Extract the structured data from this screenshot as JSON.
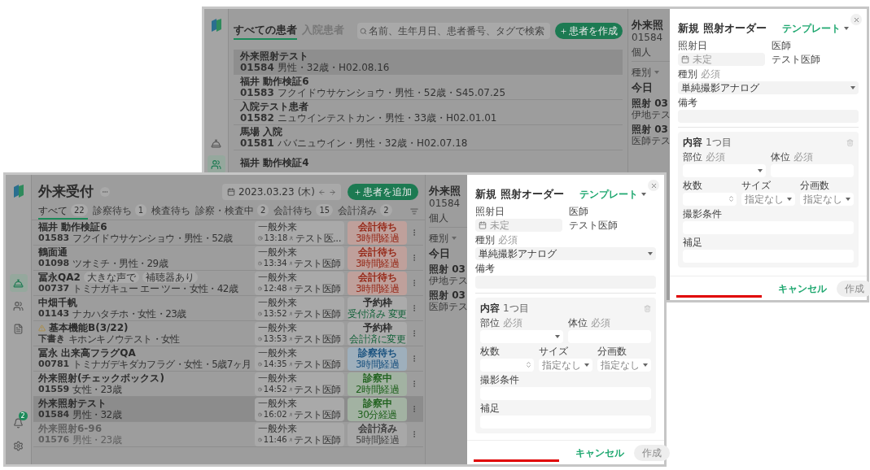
{
  "back_window": {
    "sidebar": [
      {
        "kind": "reception",
        "selected": false
      },
      {
        "kind": "patients",
        "selected": true
      }
    ],
    "tabs": [
      {
        "label": "すべての患者",
        "selected": true
      },
      {
        "label": "入院患者",
        "selected": false
      }
    ],
    "search": {
      "placeholder": "名前、生年月日、患者番号、タグで検索"
    },
    "add_button": "患者を作成",
    "patients": [
      {
        "name": "外来照射テスト",
        "id": "01584",
        "details": "男性・32歳・H02.08.16",
        "selected": true
      },
      {
        "name": "福井 動作検証6",
        "id": "01583",
        "details": "フクイドウサケンショウ・男性・52歳・S45.07.25",
        "selected": false
      },
      {
        "name": "入院テスト患者",
        "id": "01582",
        "details": "ニュウインテストカン・男性・33歳・H02.01.01",
        "selected": false
      },
      {
        "name": "馬場 入院",
        "id": "01581",
        "details": "ババニュウイン・男性・32歳・H02.07.18",
        "selected": false
      },
      {
        "name": "福井 動作検証4",
        "selected": false
      }
    ],
    "detail": {
      "title": "外来照",
      "id": "01584",
      "tab": "個人",
      "filter": "種別",
      "section": "今日",
      "entries": [
        {
          "title": "照射 03",
          "subtitle": "伊地テス"
        },
        {
          "title": "照射 03",
          "subtitle": "医師テス"
        }
      ]
    },
    "modal": {
      "title": "新規 照射オーダー",
      "template": "テンプレート",
      "rows": [
        [
          {
            "kind": "date",
            "label": "照射日",
            "placeholder": "未定"
          },
          {
            "kind": "static",
            "label": "医師",
            "value": "テスト医師"
          }
        ],
        [
          {
            "kind": "select",
            "label": "種別",
            "required": "必須",
            "value": "単純撮影アナログ"
          }
        ],
        [
          {
            "kind": "text",
            "label": "備考"
          }
        ]
      ],
      "section": {
        "title": "内容",
        "count": "1つ目",
        "rows": [
          [
            {
              "kind": "select",
              "label": "部位",
              "required": "必須"
            },
            {
              "kind": "text",
              "label": "体位",
              "required": "必須"
            }
          ],
          [
            {
              "kind": "number",
              "label": "枚数"
            },
            {
              "kind": "select",
              "label": "サイズ",
              "placeholder": "指定なし"
            },
            {
              "kind": "select",
              "label": "分画数",
              "placeholder": "指定なし"
            }
          ],
          [
            {
              "kind": "text",
              "label": "撮影条件"
            }
          ],
          [
            {
              "kind": "text",
              "label": "補足"
            }
          ]
        ]
      },
      "cancel": "キャンセル",
      "create": {
        "label": "作成",
        "disabled": true
      }
    }
  },
  "front_window": {
    "sidebar": [
      {
        "kind": "reception",
        "selected": true
      },
      {
        "kind": "patients",
        "selected": false
      },
      {
        "kind": "document",
        "selected": false
      },
      {
        "kind": "notifications",
        "selected": false,
        "badge": "2"
      },
      {
        "kind": "settings",
        "selected": false
      }
    ],
    "title": "外来受付",
    "date": "2023.03.23",
    "weekday": "(木)",
    "add_button": "患者を追加",
    "tabs": [
      {
        "label": "すべて",
        "count": "22",
        "selected": true
      },
      {
        "label": "診察待ち",
        "count": "1",
        "selected": false
      },
      {
        "label": "検査待ち",
        "selected": false
      },
      {
        "label": "診察・検査中",
        "count": "2",
        "selected": false
      },
      {
        "label": "会計待ち",
        "count": "15",
        "selected": false
      },
      {
        "label": "会計済み",
        "count": "2",
        "selected": false
      }
    ],
    "visits": [
      {
        "name": "福井 動作検証6",
        "warning": false,
        "id": "01583",
        "details": "フクイドウサケンショウ・男性・52歳",
        "visit_type": "一般外来",
        "time": "13:18",
        "doctor": "テスト医...",
        "status": {
          "kind": "billing",
          "label": "会計待ち",
          "note": "3時間経過"
        },
        "selected": false,
        "disabled": false
      },
      {
        "name": "鶴面通",
        "warning": false,
        "id": "01098",
        "details": "ツオミチ・男性・29歳",
        "visit_type": "一般外来",
        "time": "13:34",
        "doctor": "テスト医師",
        "status": {
          "kind": "billing",
          "label": "会計待ち",
          "note": "3時間経過"
        },
        "selected": false,
        "disabled": false
      },
      {
        "name": "冨永QA2",
        "tags": [
          "大きな声で",
          "補聴器あり"
        ],
        "warning": false,
        "id": "00737",
        "details": "トミナガキュー エー ツー・女性・42歳",
        "visit_type": "一般外来",
        "time": "12:48",
        "doctor": "テスト医師",
        "status": {
          "kind": "billing",
          "label": "会計待ち",
          "note": "3時間経過"
        },
        "selected": false,
        "disabled": false
      },
      {
        "name": "中畑千帆",
        "warning": false,
        "id": "01143",
        "details": "ナカハタチホ・女性・23歳",
        "visit_type": "一般外来",
        "time": "13:52",
        "doctor": "テスト医師",
        "status": {
          "kind": "reserved",
          "label": "予約枠",
          "note": "受付済み 変更"
        },
        "selected": false,
        "disabled": false
      },
      {
        "name": "基本機能B(3/22)",
        "warning": true,
        "id": "下書き",
        "details": "キホンキノウテスト・女性",
        "visit_type": "一般外来",
        "time": "13:53",
        "doctor": "テスト医師",
        "status": {
          "kind": "reserved",
          "label": "予約枠",
          "note": "会計済に変更"
        },
        "selected": false,
        "disabled": false
      },
      {
        "name": "冨永 出来高フラグQA",
        "warning": false,
        "id": "00781",
        "details": "トミナガデキダカフラグ・女性・5歳7ヶ月",
        "visit_type": "一般外来",
        "time": "14:35",
        "doctor": "テスト医師",
        "status": {
          "kind": "waiting",
          "label": "診察待ち",
          "note": "3時間経過"
        },
        "selected": false,
        "disabled": false
      },
      {
        "name": "外来照射(チェックボックス)",
        "warning": false,
        "id": "01559",
        "details": "女性・23歳",
        "visit_type": "一般外来",
        "time": "14:52",
        "doctor": "テスト医師",
        "status": {
          "kind": "in_exam",
          "label": "診察中",
          "note": "2時間経過"
        },
        "selected": false,
        "disabled": false
      },
      {
        "name": "外来照射テスト",
        "warning": false,
        "id": "01584",
        "details": "男性・32歳",
        "visit_type": "一般外来",
        "time": "16:02",
        "doctor": "テスト医師",
        "status": {
          "kind": "in_exam",
          "label": "診察中",
          "note": "30分経過"
        },
        "selected": true,
        "disabled": false
      },
      {
        "name": "外来照射6-96",
        "warning": false,
        "id": "01576",
        "details": "男性・23歳",
        "visit_type": "一般外来",
        "time": "11:46",
        "doctor": "テスト医師",
        "status": {
          "kind": "done",
          "label": "会計済み",
          "note": "5時間経過"
        },
        "selected": false,
        "disabled": true
      }
    ],
    "detail": {
      "title": "外来照",
      "id": "01584",
      "tab": "個人",
      "filter": "種別",
      "section": "今日",
      "entries": [
        {
          "title": "照射 03",
          "subtitle": "伊地テス"
        },
        {
          "title": "照射 03",
          "subtitle": "医師テス"
        }
      ]
    },
    "modal": {
      "title": "新規 照射オーダー",
      "template": "テンプレート",
      "rows": [
        [
          {
            "kind": "date",
            "label": "照射日",
            "placeholder": "未定"
          },
          {
            "kind": "static",
            "label": "医師",
            "value": "テスト医師"
          }
        ],
        [
          {
            "kind": "select",
            "label": "種別",
            "required": "必須",
            "value": "単純撮影アナログ"
          }
        ],
        [
          {
            "kind": "text",
            "label": "備考"
          }
        ]
      ],
      "section": {
        "title": "内容",
        "count": "1つ目",
        "rows": [
          [
            {
              "kind": "select",
              "label": "部位",
              "required": "必須"
            },
            {
              "kind": "text",
              "label": "体位",
              "required": "必須"
            }
          ],
          [
            {
              "kind": "number",
              "label": "枚数"
            },
            {
              "kind": "select",
              "label": "サイズ",
              "placeholder": "指定なし"
            },
            {
              "kind": "select",
              "label": "分画数",
              "placeholder": "指定なし"
            }
          ],
          [
            {
              "kind": "text",
              "label": "撮影条件"
            }
          ],
          [
            {
              "kind": "text",
              "label": "補足"
            }
          ]
        ]
      },
      "cancel": "キャンセル",
      "create": {
        "label": "作成",
        "disabled": true
      }
    }
  }
}
